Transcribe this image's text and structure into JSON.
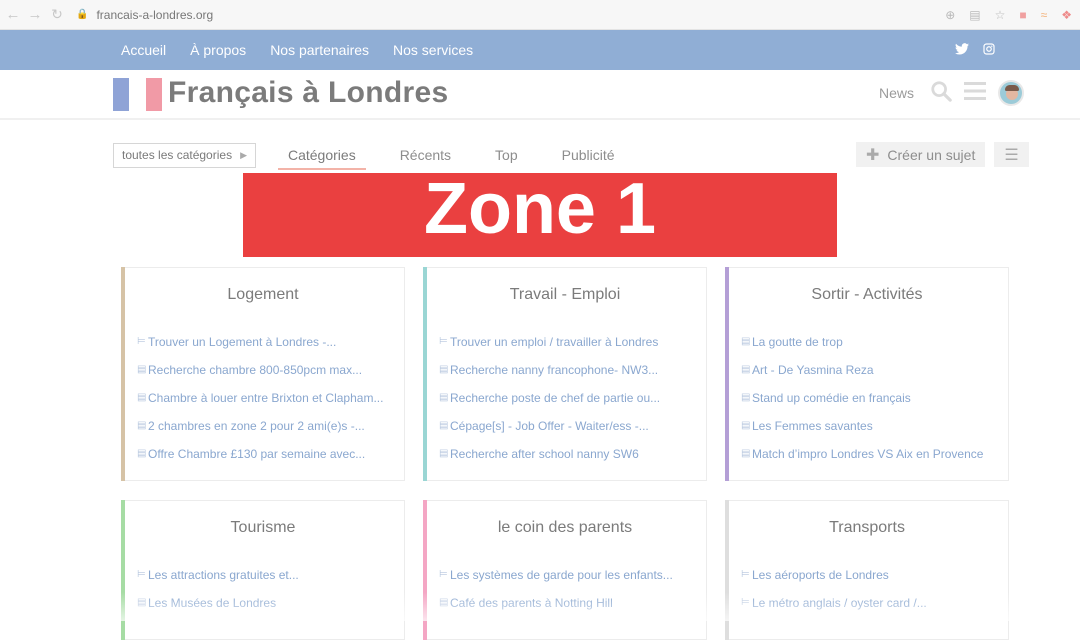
{
  "browser": {
    "url": "francais-a-londres.org",
    "icons": [
      "back-icon",
      "forward-icon",
      "reload-icon",
      "lock-icon",
      "zoom-icon",
      "translate-icon",
      "star-icon",
      "extension-icon",
      "rss-icon",
      "pocket-icon"
    ]
  },
  "topnav": {
    "items": [
      "Accueil",
      "À propos",
      "Nos partenaires",
      "Nos services"
    ],
    "social": [
      "twitter-icon",
      "instagram-icon"
    ],
    "color": "#90aed5"
  },
  "header": {
    "logo": "Français à Londres",
    "news_label": "News",
    "flag_colors": [
      "#8fa3d6",
      "#f19aa6"
    ]
  },
  "filters": {
    "category_dropdown": "toutes les catégories",
    "tabs": [
      "Catégories",
      "Récents",
      "Top",
      "Publicité"
    ],
    "active_tab": "Catégories",
    "create_label": "Créer un sujet"
  },
  "banner": {
    "text": "Zone 1",
    "color": "#ea4040"
  },
  "categories": [
    {
      "title": "Logement",
      "color": "#d6c3a6",
      "topics": [
        {
          "icon": "pin",
          "text": "Trouver un Logement à Londres -..."
        },
        {
          "icon": "doc",
          "text": "Recherche chambre 800-850pcm max..."
        },
        {
          "icon": "doc",
          "text": "Chambre à louer entre Brixton et Clapham..."
        },
        {
          "icon": "doc",
          "text": "2 chambres en zone 2 pour 2 ami(e)s -..."
        },
        {
          "icon": "doc",
          "text": "Offre Chambre £130 par semaine avec..."
        }
      ]
    },
    {
      "title": "Travail - Emploi",
      "color": "#9ad6d4",
      "topics": [
        {
          "icon": "pin",
          "text": "Trouver un emploi / travailler à Londres"
        },
        {
          "icon": "doc",
          "text": "Recherche nanny francophone- NW3..."
        },
        {
          "icon": "doc",
          "text": "Recherche poste de chef de partie ou..."
        },
        {
          "icon": "doc",
          "text": "Cépage[s] - Job Offer - Waiter/ess -..."
        },
        {
          "icon": "doc",
          "text": "Recherche after school nanny SW6"
        }
      ]
    },
    {
      "title": "Sortir - Activités",
      "color": "#b49fd6",
      "topics": [
        {
          "icon": "doc",
          "text": "La goutte de trop"
        },
        {
          "icon": "doc",
          "text": "Art - De Yasmina Reza"
        },
        {
          "icon": "doc",
          "text": "Stand up comédie en français"
        },
        {
          "icon": "doc",
          "text": "Les Femmes savantes"
        },
        {
          "icon": "doc",
          "text": "Match d’impro Londres VS Aix en Provence"
        }
      ]
    },
    {
      "title": "Tourisme",
      "color": "#a6dca4",
      "topics": [
        {
          "icon": "pin",
          "text": "Les attractions gratuites et..."
        },
        {
          "icon": "doc",
          "text": "Les Musées de Londres"
        }
      ]
    },
    {
      "title": "le coin des parents",
      "color": "#f4a6c4",
      "topics": [
        {
          "icon": "pin",
          "text": "Les systèmes de garde pour les enfants..."
        },
        {
          "icon": "doc",
          "text": "Café des parents à Notting Hill"
        }
      ]
    },
    {
      "title": "Transports",
      "color": "#dedede",
      "topics": [
        {
          "icon": "pin",
          "text": "Les aéroports de Londres"
        },
        {
          "icon": "pin",
          "text": "Le métro anglais / oyster card /..."
        }
      ]
    }
  ]
}
